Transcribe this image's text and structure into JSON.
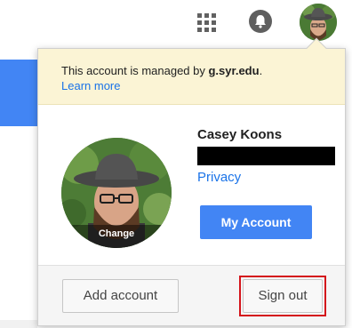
{
  "topbar": {
    "apps_icon": "apps-grid-icon",
    "notifications_icon": "bell-icon",
    "avatar": "user-avatar"
  },
  "account_panel": {
    "notice": {
      "prefix": "This account is managed by ",
      "domain": "g.syr.edu",
      "suffix": ".",
      "learn_more": "Learn more"
    },
    "profile": {
      "avatar_change_label": "Change",
      "name": "Casey Koons",
      "email": "",
      "privacy_link": "Privacy",
      "my_account_button": "My Account"
    },
    "footer": {
      "add_account_button": "Add account",
      "sign_out_button": "Sign out"
    }
  },
  "colors": {
    "accent_blue": "#4285f4",
    "link_blue": "#1a73e8",
    "notice_bg": "#fbf4d5",
    "highlight_red": "#d4141b"
  }
}
